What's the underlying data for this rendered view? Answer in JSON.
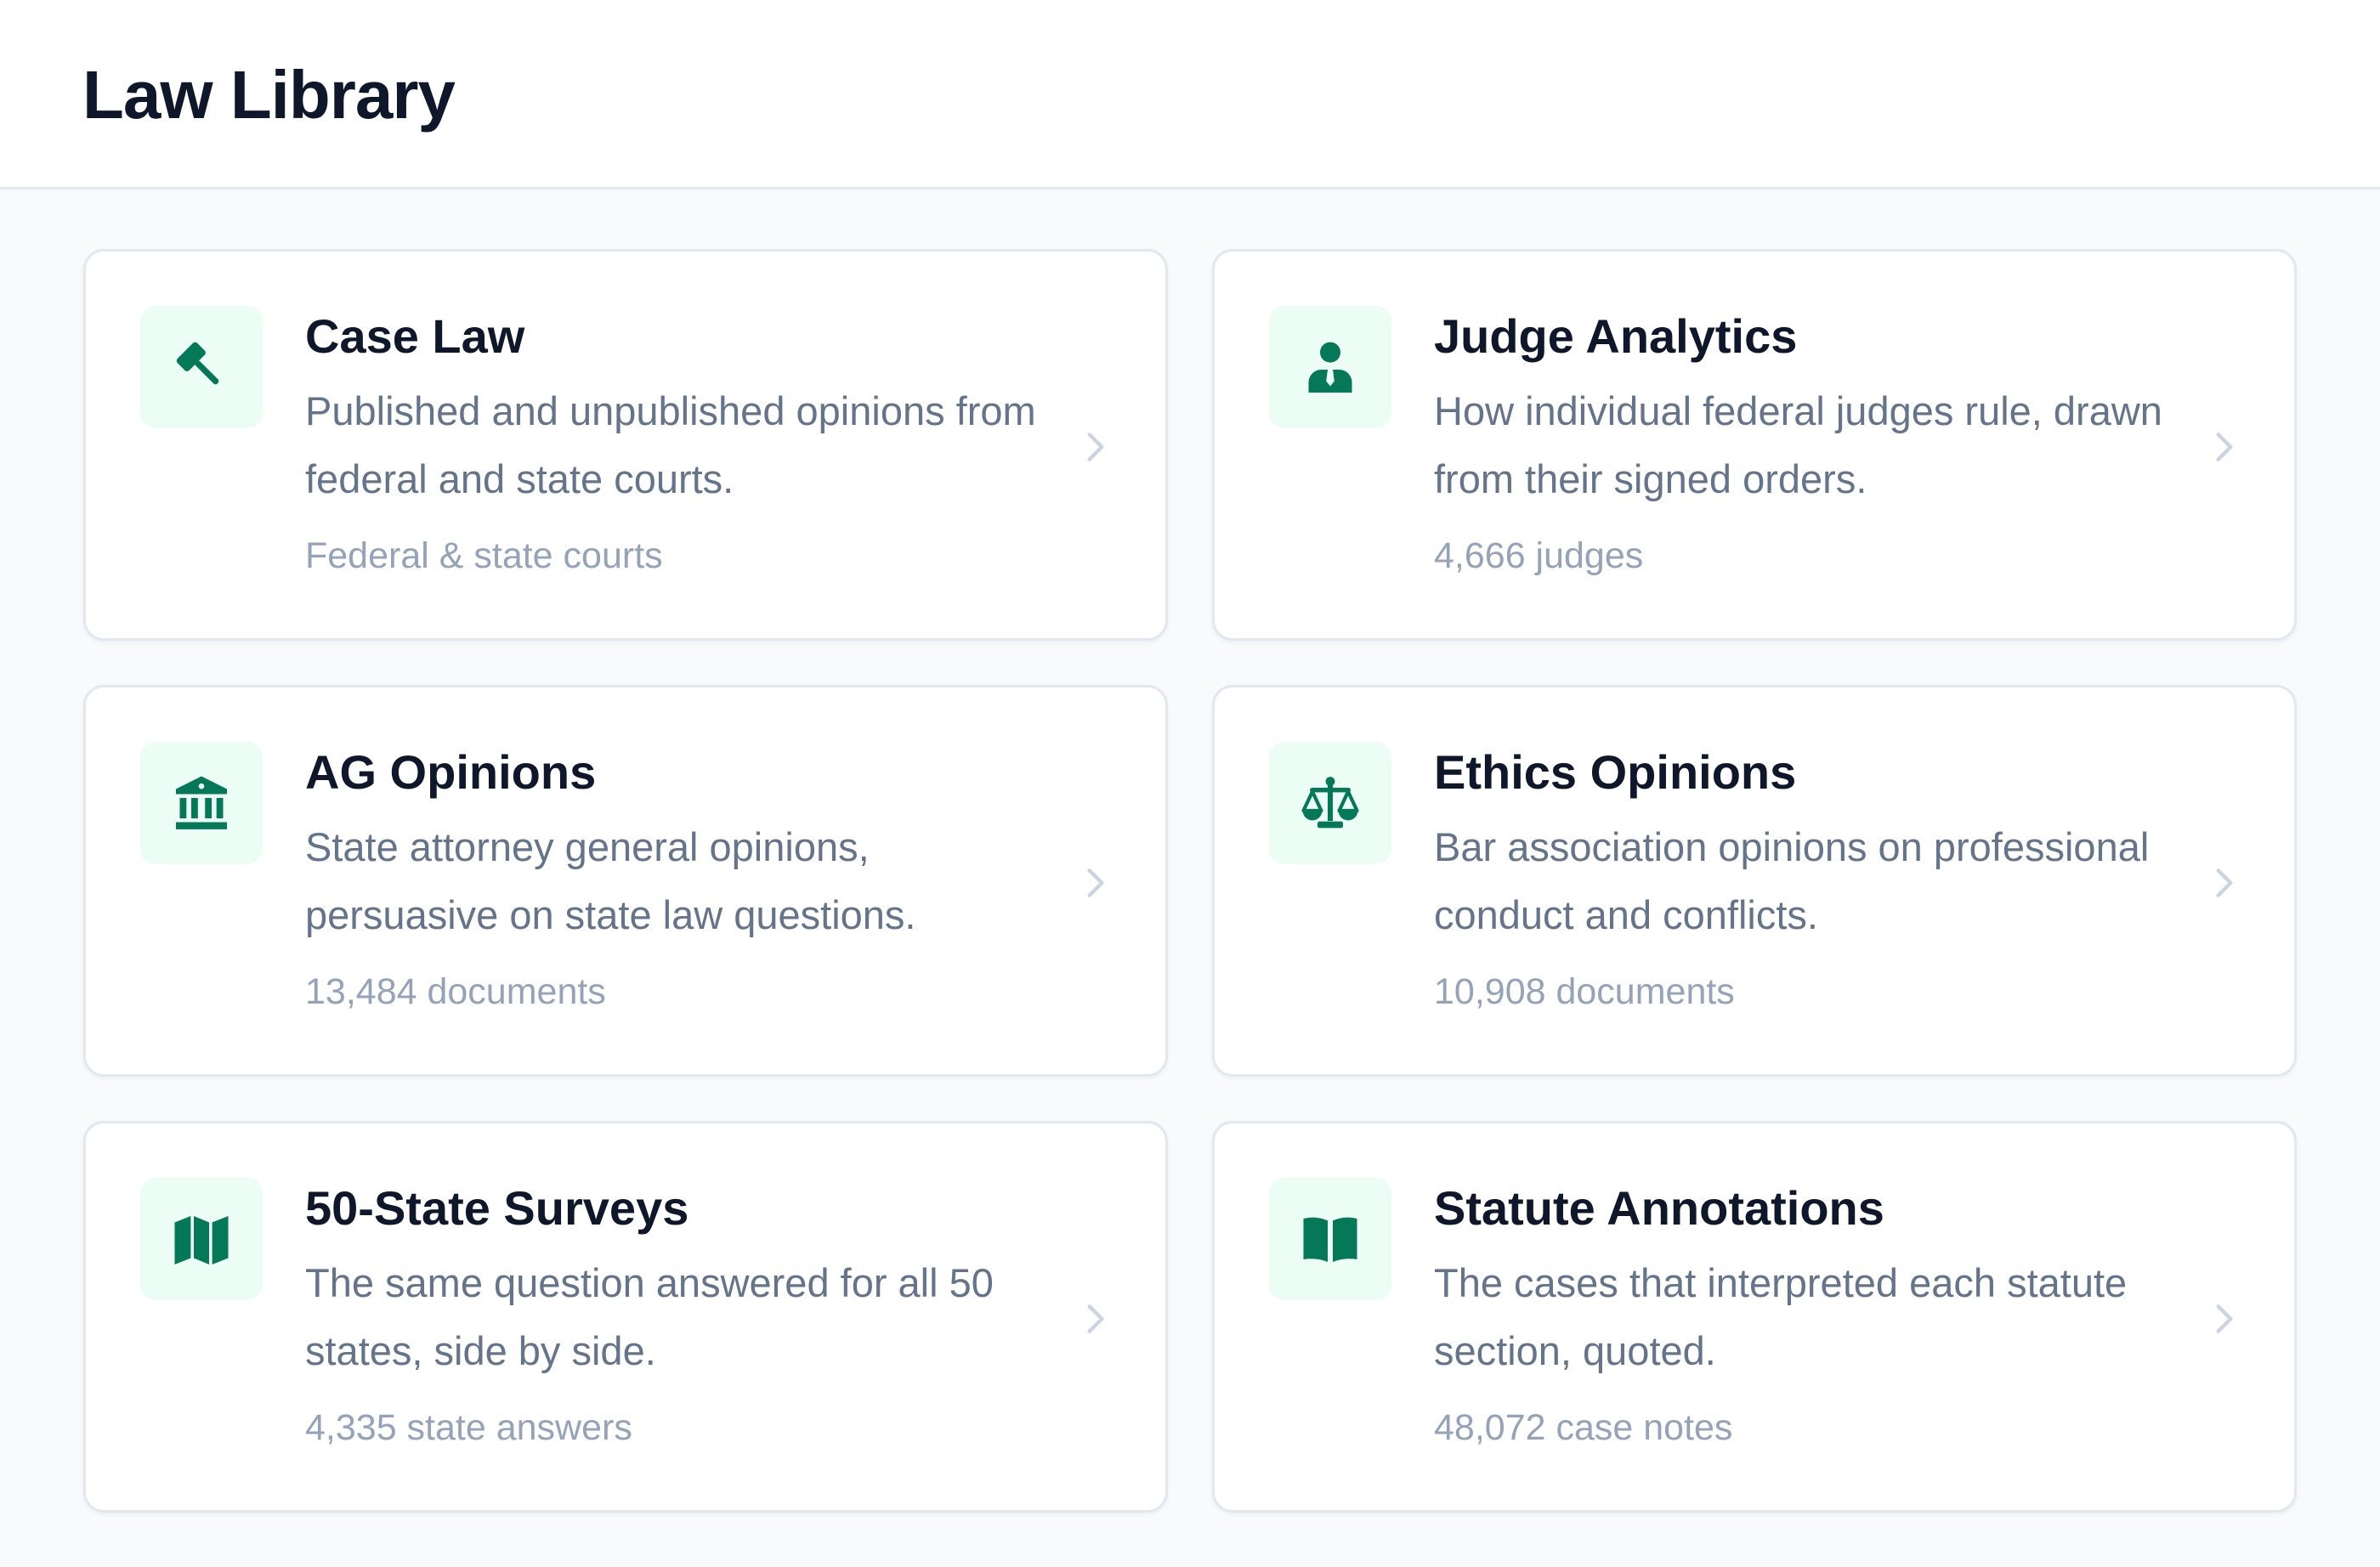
{
  "header": {
    "title": "Law Library"
  },
  "colors": {
    "accent": "#047857",
    "icon_bg": "#ecfdf5",
    "title_text": "#0f172a",
    "body_text": "#64748b",
    "muted_text": "#94a3b8",
    "border": "#e2e8f0",
    "page_bg": "#f8fafc"
  },
  "cards": [
    {
      "icon": "gavel-icon",
      "title": "Case Law",
      "description": "Published and unpublished opinions from federal and state courts.",
      "meta": "Federal & state courts"
    },
    {
      "icon": "judge-icon",
      "title": "Judge Analytics",
      "description": "How individual federal judges rule, drawn from their signed orders.",
      "meta": "4,666 judges"
    },
    {
      "icon": "landmark-icon",
      "title": "AG Opinions",
      "description": "State attorney general opinions, persuasive on state law questions.",
      "meta": "13,484 documents"
    },
    {
      "icon": "scale-icon",
      "title": "Ethics Opinions",
      "description": "Bar association opinions on professional conduct and conflicts.",
      "meta": "10,908 documents"
    },
    {
      "icon": "map-icon",
      "title": "50-State Surveys",
      "description": "The same question answered for all 50 states, side by side.",
      "meta": "4,335 state answers"
    },
    {
      "icon": "book-open-icon",
      "title": "Statute Annotations",
      "description": "The cases that interpreted each statute section, quoted.",
      "meta": "48,072 case notes"
    }
  ]
}
